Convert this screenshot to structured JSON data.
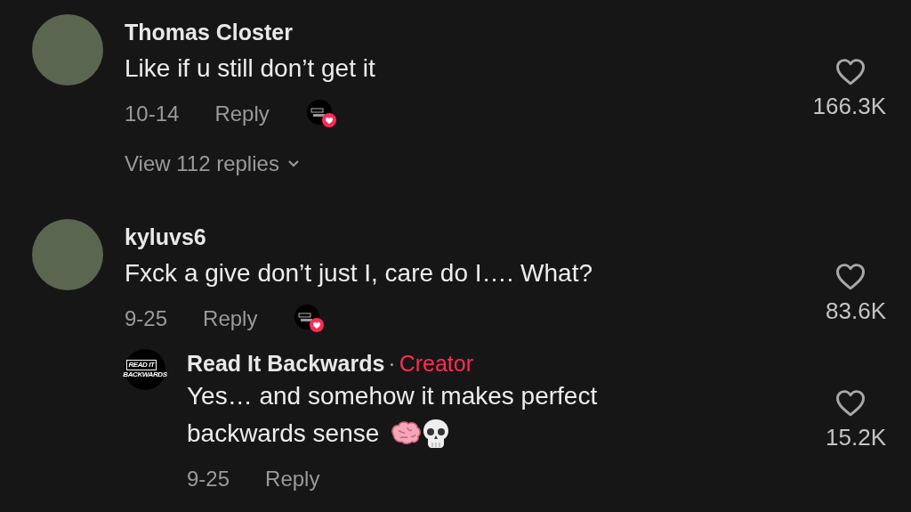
{
  "comments": [
    {
      "author": "Thomas Closter",
      "text": "Like if u still don’t get it",
      "date": "10-14",
      "reply_label": "Reply",
      "creator_liked": true,
      "likes": "166.3K",
      "liked": false,
      "view_replies": "View 112 replies"
    },
    {
      "author": "kyluvs6",
      "text": "Fxck a give don’t just I, care do I…. What?",
      "date": "9-25",
      "reply_label": "Reply",
      "creator_liked": true,
      "likes": "83.6K",
      "liked": false,
      "replies": [
        {
          "author": "Read It Backwards",
          "logo_lines": [
            "READ IT",
            "BACKWARDS"
          ],
          "separator": "·",
          "badge": "Creator",
          "text_lines": [
            "Yes… and somehow it makes perfect",
            "backwards sense"
          ],
          "emojis": [
            {
              "kind": "brain"
            },
            {
              "kind": "skull"
            }
          ],
          "date": "9-25",
          "reply_label": "Reply",
          "likes": "15.2K",
          "liked": false
        }
      ]
    }
  ]
}
